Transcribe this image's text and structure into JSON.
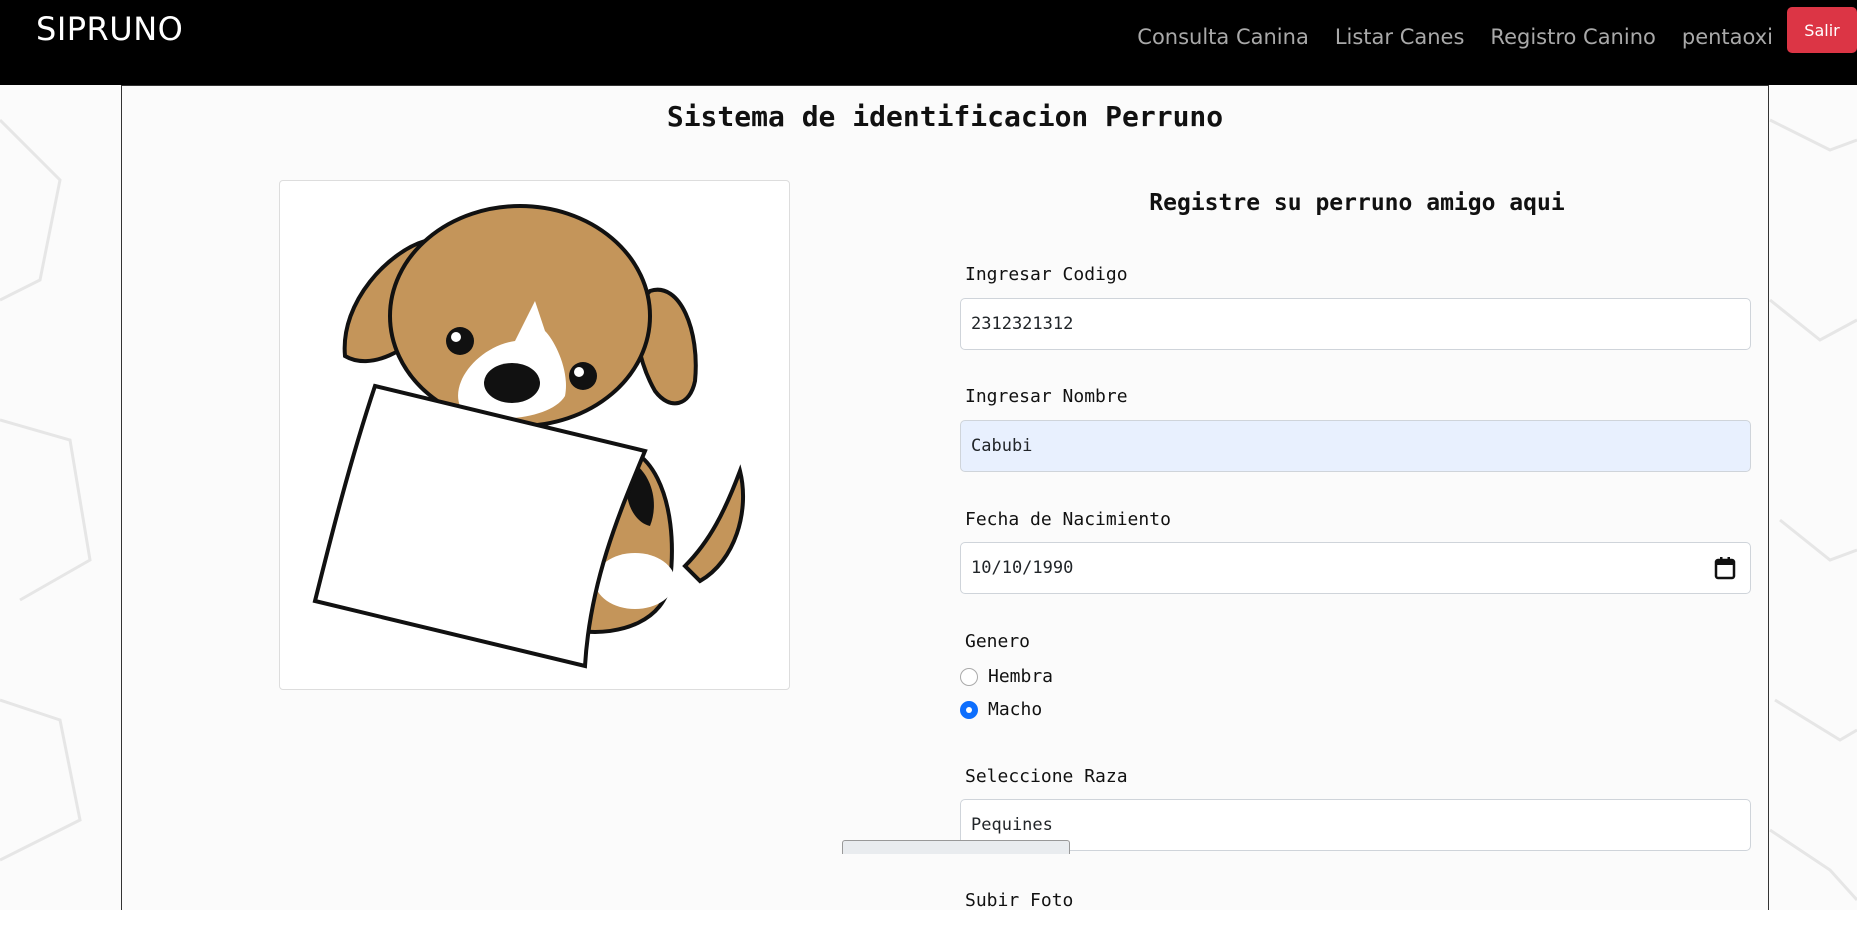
{
  "navbar": {
    "brand": "SIPRUNO",
    "links": [
      "Consulta Canina",
      "Listar Canes",
      "Registro Canino",
      "pentaoxi"
    ],
    "logout_label": "Salir",
    "logout_color": "#dc3545"
  },
  "page": {
    "title": "Sistema de identificacion Perruno"
  },
  "form": {
    "title": "Registre su perruno amigo aqui",
    "code_label": "Ingresar Codigo",
    "code_value": "2312321312",
    "name_label": "Ingresar Nombre",
    "name_value": "Cabubi",
    "birth_label": "Fecha de Nacimiento",
    "birth_value": "10/10/1990",
    "gender_label": "Genero",
    "gender_options": [
      "Hembra",
      "Macho"
    ],
    "gender_selected": "Macho",
    "breed_label": "Seleccione Raza",
    "breed_value": "Pequines",
    "photo_label": "Subir Foto"
  },
  "icons": {
    "calendar": "calendar-icon",
    "illustration": "dog-holding-paper-illustration"
  },
  "colors": {
    "accent": "#0d6efd",
    "autofill": "#e8f0fe",
    "dog_fur": "#c4955a"
  }
}
